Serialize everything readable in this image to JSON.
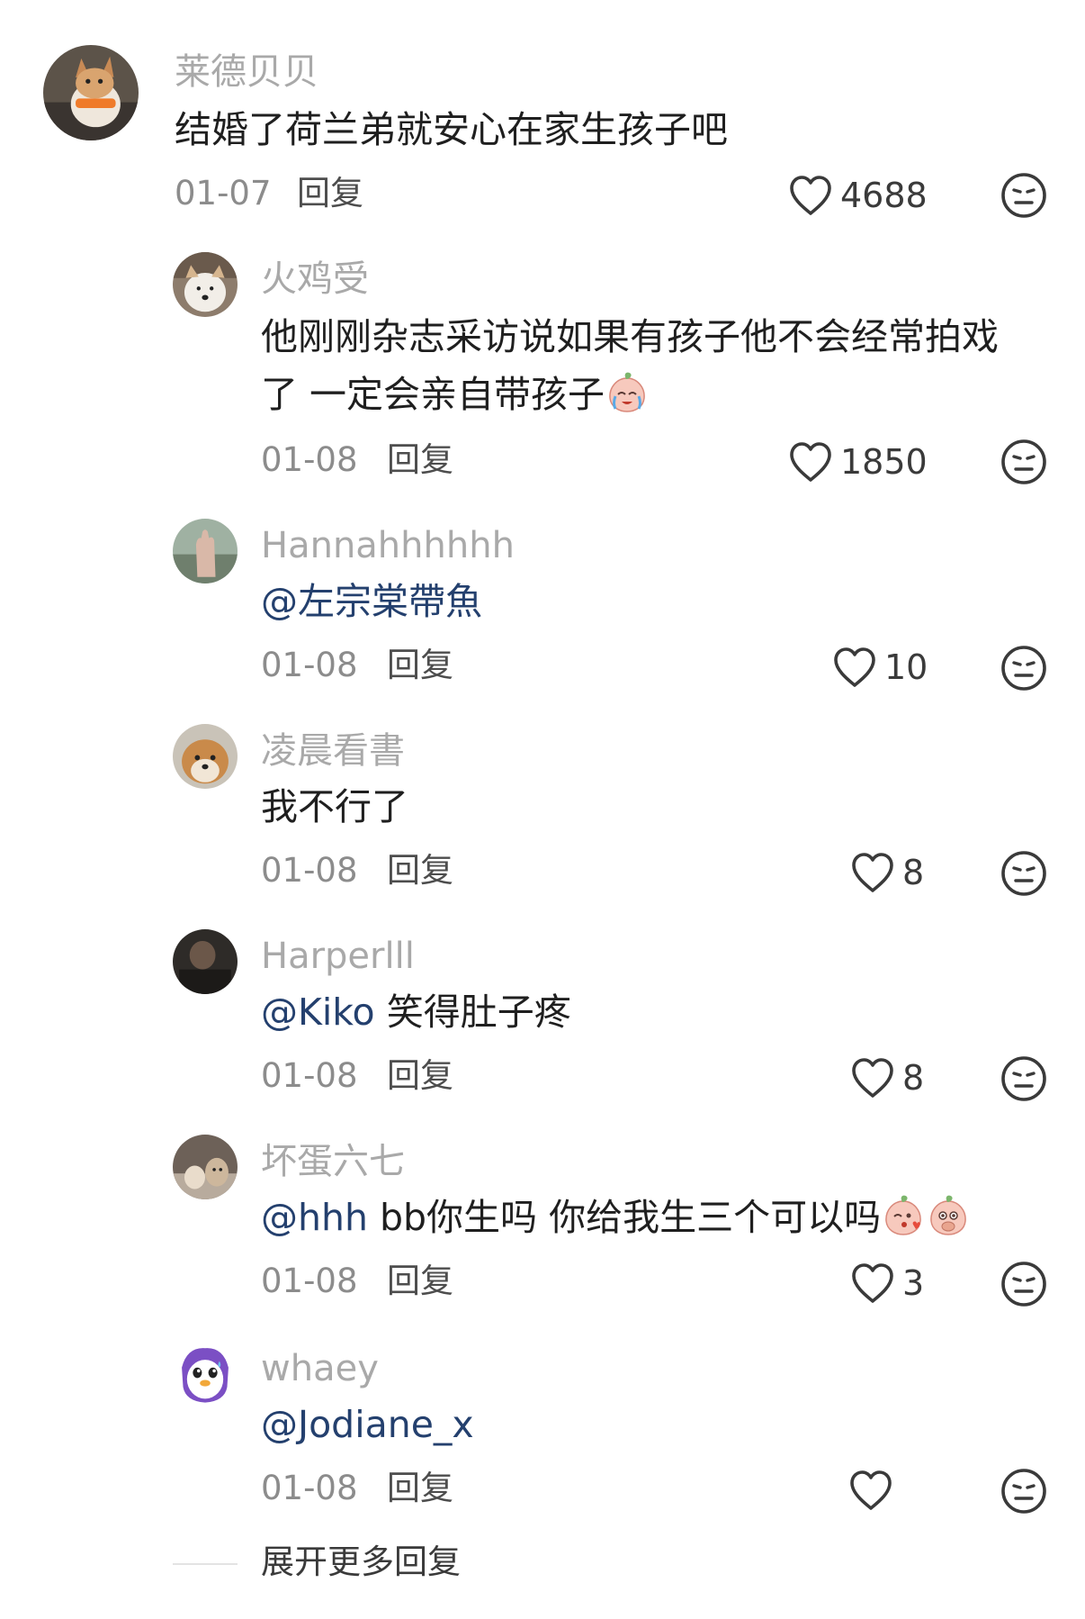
{
  "comments": [
    {
      "author": "莱德贝贝",
      "text": "结婚了荷兰弟就安心在家生孩子吧",
      "date": "01-07",
      "reply_label": "回复",
      "likes": "4688",
      "avatar_icon": "corgi-dog-avatar"
    },
    {
      "author": "火鸡受",
      "text_line1": "他刚刚杂志采访说如果有孩子他不会经常拍戏",
      "text_line2": "了 一定会亲自带孩子",
      "emoji": "crying-peach-emoji",
      "date": "01-08",
      "reply_label": "回复",
      "likes": "1850",
      "avatar_icon": "dog-avatar"
    },
    {
      "author": "Hannahhhhhh",
      "mention": "@左宗棠帶魚",
      "date": "01-08",
      "reply_label": "回复",
      "likes": "10",
      "avatar_icon": "hand-sky-avatar"
    },
    {
      "author": "凌晨看書",
      "text": "我不行了",
      "date": "01-08",
      "reply_label": "回复",
      "likes": "8",
      "avatar_icon": "shiba-dog-avatar"
    },
    {
      "author": "Harperlll",
      "mention": "@Kiko",
      "text": " 笑得肚子疼",
      "date": "01-08",
      "reply_label": "回复",
      "likes": "8",
      "avatar_icon": "dark-photo-avatar"
    },
    {
      "author": "坏蛋六七",
      "mention": "@hhh",
      "text": " bb你生吗 你给我生三个可以吗",
      "emojis": [
        "kissing-peach-emoji",
        "shy-peach-emoji"
      ],
      "date": "01-08",
      "reply_label": "回复",
      "likes": "3",
      "avatar_icon": "cats-avatar"
    },
    {
      "author": "whaey",
      "mention": "@Jodiane_x",
      "date": "01-08",
      "reply_label": "回复",
      "likes": "",
      "avatar_icon": "purple-penguin-avatar"
    }
  ],
  "expand_label": "展开更多回复",
  "colors": {
    "author": "#a9a9a9",
    "text": "#1f1f1f",
    "mention": "#24406e",
    "meta": "#8c8c8c",
    "icon": "#3a3a3a"
  }
}
